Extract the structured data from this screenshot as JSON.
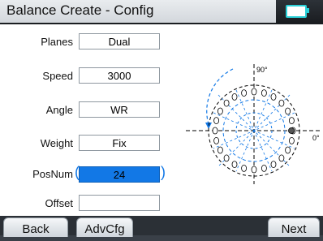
{
  "header": {
    "title": "Balance Create - Config",
    "battery_icon": "battery-icon"
  },
  "form": {
    "planes": {
      "label": "Planes",
      "value": "Dual"
    },
    "speed": {
      "label": "Speed",
      "value": "3000"
    },
    "angle": {
      "label": "Angle",
      "value": "WR"
    },
    "weight": {
      "label": "Weight",
      "value": "Fix"
    },
    "posnum": {
      "label": "PosNum",
      "value": "24"
    },
    "offset": {
      "label": "Offset",
      "value": ""
    }
  },
  "diagram": {
    "label_90": "90°",
    "label_0": "0°"
  },
  "buttons": {
    "back": "Back",
    "advcfg": "AdvCfg",
    "next": "Next"
  },
  "colors": {
    "accent": "#1278e6",
    "title_bg": "#dfe3e7",
    "battery": "#2ad0d8"
  }
}
